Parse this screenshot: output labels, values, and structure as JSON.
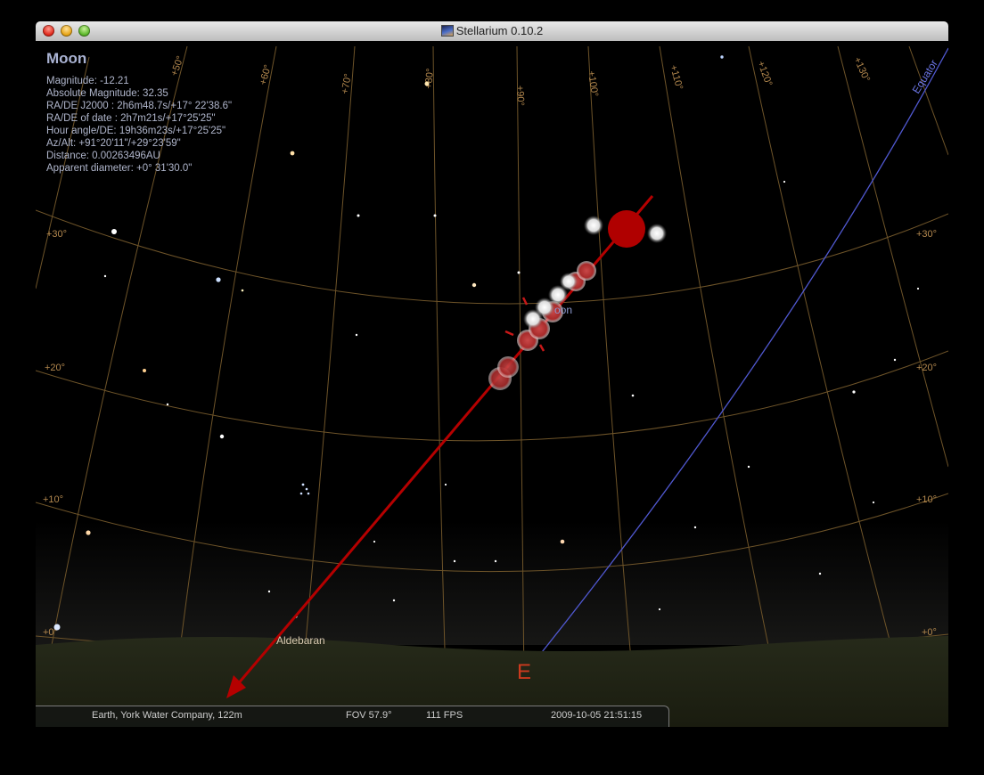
{
  "window": {
    "title": "Stellarium 0.10.2"
  },
  "info": {
    "name": "Moon",
    "lines": [
      "Magnitude: -12.21",
      "Absolute Magnitude: 32.35",
      "RA/DE  J2000 : 2h6m48.7s/+17° 22'38.6\"",
      "RA/DE  of date : 2h7m21s/+17°25'25\"",
      "Hour angle/DE: 19h36m23s/+17°25'25\"",
      "Az/Alt: +91°20'11\"/+29°23'59\"",
      "Distance: 0.00263496AU",
      "Apparent diameter: +0° 31'30.0\""
    ]
  },
  "sky_labels": {
    "moon": "oon",
    "aldebaran": "Aldebaran",
    "cardinal_east": "E",
    "equator": "Equator",
    "alt_left": [
      "+30°",
      "+20°",
      "+10°",
      "+0°"
    ],
    "alt_right": [
      "+30°",
      "+20°",
      "+10°",
      "+0°"
    ],
    "ra_top": [
      "+50°",
      "+60°",
      "+70°",
      "+80°",
      "+90°",
      "+100°",
      "+110°",
      "+120°",
      "+130°"
    ]
  },
  "colors": {
    "arrow": "#b50000",
    "grid": "#7a5a2a",
    "equator": "#5560d8"
  },
  "status": {
    "location": "Earth, York Water Company, 122m",
    "fov": "FOV 57.9°",
    "fps": "111 FPS",
    "datetime": "2009-10-05   21:51:15"
  }
}
